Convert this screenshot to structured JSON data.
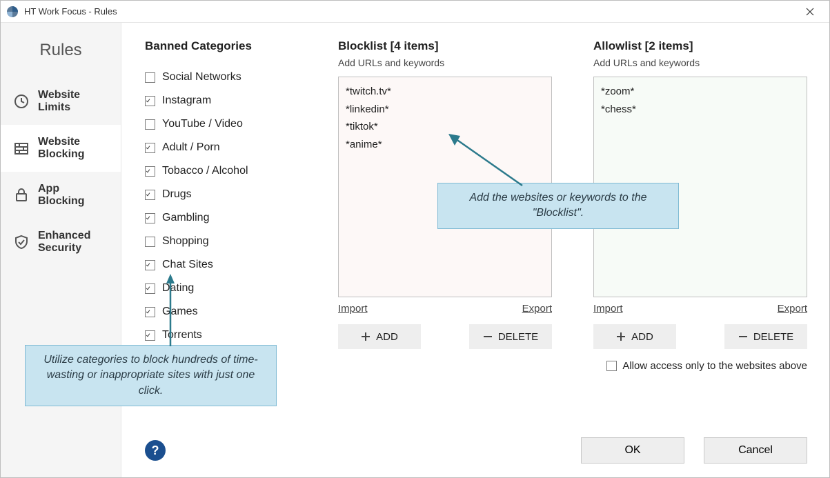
{
  "window": {
    "title": "HT Work Focus - Rules"
  },
  "sidebar": {
    "title": "Rules",
    "items": [
      {
        "label": "Website Limits",
        "icon": "clock-icon",
        "active": false
      },
      {
        "label": "Website Blocking",
        "icon": "firewall-icon",
        "active": true
      },
      {
        "label": "App Blocking",
        "icon": "lock-icon",
        "active": false
      },
      {
        "label": "Enhanced Security",
        "icon": "shield-icon",
        "active": false
      }
    ]
  },
  "categories": {
    "title": "Banned Categories",
    "items": [
      {
        "label": "Social Networks",
        "checked": false
      },
      {
        "label": "Instagram",
        "checked": true
      },
      {
        "label": "YouTube / Video",
        "checked": false
      },
      {
        "label": "Adult / Porn",
        "checked": true
      },
      {
        "label": "Tobacco / Alcohol",
        "checked": true
      },
      {
        "label": "Drugs",
        "checked": true
      },
      {
        "label": "Gambling",
        "checked": true
      },
      {
        "label": "Shopping",
        "checked": false
      },
      {
        "label": "Chat Sites",
        "checked": true
      },
      {
        "label": "Dating",
        "checked": true
      },
      {
        "label": "Games",
        "checked": true
      },
      {
        "label": "Torrents",
        "checked": true
      }
    ]
  },
  "blocklist": {
    "title": "Blocklist [4 items]",
    "subtitle": "Add URLs and keywords",
    "items": [
      "*twitch.tv*",
      "*linkedin*",
      "*tiktok*",
      "*anime*"
    ],
    "import_label": "Import",
    "export_label": "Export",
    "add_label": "ADD",
    "delete_label": "DELETE"
  },
  "allowlist": {
    "title": "Allowlist [2 items]",
    "subtitle": "Add URLs and keywords",
    "items": [
      "*zoom*",
      "*chess*"
    ],
    "import_label": "Import",
    "export_label": "Export",
    "add_label": "ADD",
    "delete_label": "DELETE"
  },
  "allow_only": {
    "label": "Allow access only to the websites above",
    "checked": false
  },
  "buttons": {
    "ok": "OK",
    "cancel": "Cancel"
  },
  "help": {
    "glyph": "?"
  },
  "callouts": {
    "categories": "Utilize categories to block hundreds of time-wasting or inappropriate sites with just one click.",
    "blocklist": "Add the websites or keywords to the \"Blocklist\"."
  }
}
